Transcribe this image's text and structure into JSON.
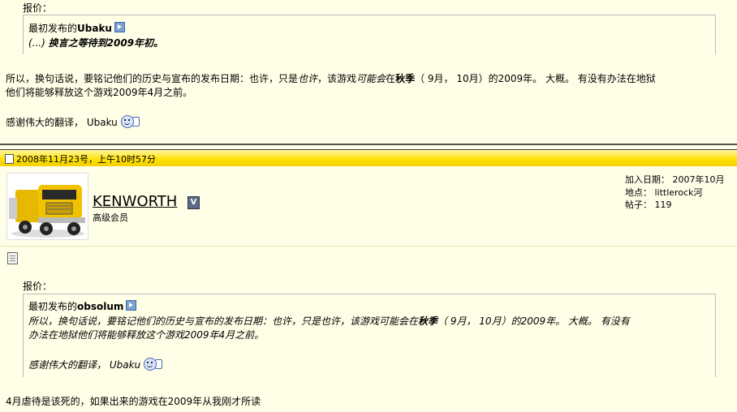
{
  "post1": {
    "quote_label": "报价：",
    "quote_author_prefix": "最初发布的",
    "quote_author": "Ubaku",
    "quote_text_prefix": "(...) ",
    "quote_text": "换言之等待到2009年初。",
    "body_line1": {
      "a": "所以，换句话说，要铭记他们的历史与宣布的发布日期：也许，只是",
      "b": "也许",
      "c": "，该游戏",
      "d": "可能会",
      "e": "在",
      "f": "秋季",
      "g": "（ 9月， 10月）的2009年。 大概。 有没有办法在地狱"
    },
    "body_line2": "他们将能够释放这个游戏2009年4月之前。",
    "thanks": "感谢伟大的翻译， Ubaku"
  },
  "post2": {
    "date": "2008年11月23号，上午10时57分",
    "username": "KENWORTH",
    "badge": "V",
    "rank": "高级会员",
    "join_label": "加入日期：",
    "join_value": "2007年10月",
    "location_label": "地点：",
    "location_value": "littlerock河",
    "posts_label": "帖子：",
    "posts_value": "119",
    "quote_label": "报价：",
    "quote_author_prefix": "最初发布的",
    "quote_author": "obsolum",
    "quote_line1": {
      "a": "所以，换句话说，要铭记他们的历史与宣布的发布日期：也许，只是也许，该游戏可能会在",
      "b": "秋季",
      "c": "（ 9月， 10月）的2009年。 大概。 有没有"
    },
    "quote_line2": "办法在地狱他们将能够释放这个游戏2009年4月之前。",
    "quote_thanks": "感谢伟大的翻译， Ubaku",
    "reply": "4月虐待是该死的，如果出来的游戏在2009年从我刚才所读"
  },
  "colors": {
    "background": "#ffffe7",
    "header_yellow": "#ffe000",
    "quote_border": "#b9b9b9"
  }
}
